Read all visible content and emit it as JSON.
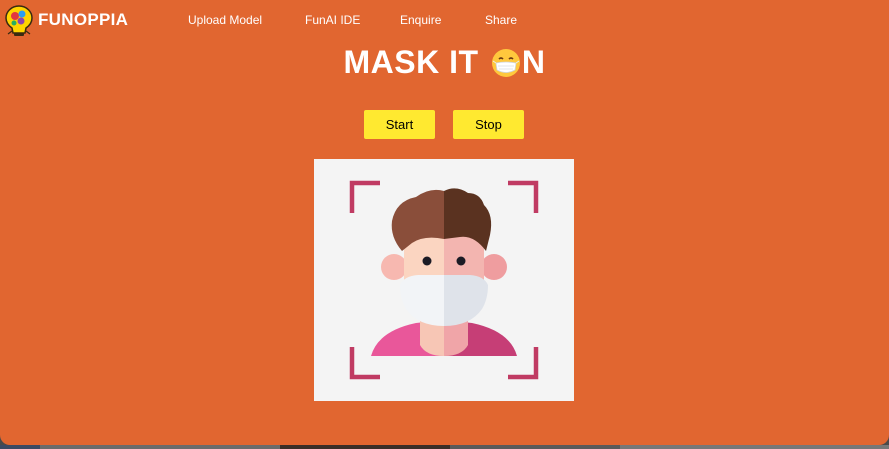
{
  "navbar": {
    "brand": "FUNOPPIA",
    "links": [
      "Upload Model",
      "FunAI IDE",
      "Enquire",
      "Share"
    ]
  },
  "hero": {
    "title_before": "MASK IT ",
    "title_emoji": "face-with-medical-mask-icon",
    "title_after": "N"
  },
  "controls": {
    "start_label": "Start",
    "stop_label": "Stop"
  },
  "preview": {
    "image": "masked-face-scan-illustration"
  },
  "colors": {
    "background": "#e16630",
    "button": "#ffe930",
    "text": "#ffffff",
    "scan_bracket": "#c03b63"
  }
}
